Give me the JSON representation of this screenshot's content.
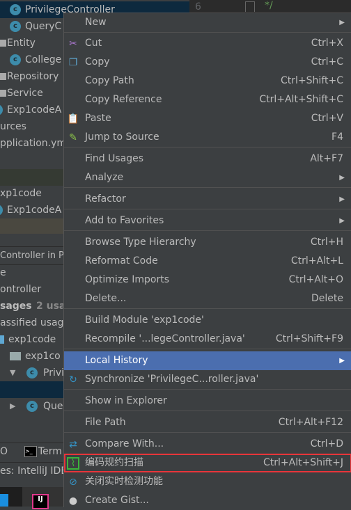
{
  "project_tree": [
    {
      "label": "PrivilegeController",
      "icon": "class-icon",
      "selected": true
    },
    {
      "label": "QueryC",
      "icon": "class-icon"
    },
    {
      "label": "Entity",
      "icon": "package-icon"
    },
    {
      "label": "College",
      "icon": "class-icon"
    },
    {
      "label": "Repository",
      "icon": "package-icon"
    },
    {
      "label": "Service",
      "icon": "package-icon"
    },
    {
      "label": "Exp1codeA",
      "icon": "spring-boot-class-icon"
    },
    {
      "label": "urces",
      "icon": ""
    },
    {
      "label": "pplication.ym",
      "icon": ""
    },
    {
      "label": "xp1code",
      "icon": ""
    },
    {
      "label": "Exp1codeA",
      "icon": "class-icon"
    }
  ],
  "find_panel": {
    "title": "Controller in Pr",
    "rows": [
      "e",
      "ontroller",
      "sages",
      "assified usage",
      "exp1code",
      "exp1co",
      "Privi",
      "Que"
    ],
    "usage_count": "2 usa"
  },
  "bottom_tabs": [
    "O",
    "Term"
  ],
  "status_text": "es: IntelliJ IDE",
  "editor": {
    "line_number": "6",
    "code": "*/"
  },
  "menu": {
    "items": [
      {
        "label": "New",
        "shortcut": "",
        "submenu": true
      },
      {
        "label": "Cut",
        "shortcut": "Ctrl+X",
        "icon": "scissors-icon"
      },
      {
        "label": "Copy",
        "shortcut": "Ctrl+C",
        "icon": "copy-icon"
      },
      {
        "label": "Copy Path",
        "shortcut": "Ctrl+Shift+C"
      },
      {
        "label": "Copy Reference",
        "shortcut": "Ctrl+Alt+Shift+C"
      },
      {
        "label": "Paste",
        "shortcut": "Ctrl+V",
        "icon": "paste-icon"
      },
      {
        "label": "Jump to Source",
        "shortcut": "F4",
        "icon": "edit-source-icon"
      },
      {
        "label": "Find Usages",
        "shortcut": "Alt+F7"
      },
      {
        "label": "Analyze",
        "shortcut": "",
        "submenu": true
      },
      {
        "label": "Refactor",
        "shortcut": "",
        "submenu": true
      },
      {
        "label": "Add to Favorites",
        "shortcut": "",
        "submenu": true
      },
      {
        "label": "Browse Type Hierarchy",
        "shortcut": "Ctrl+H"
      },
      {
        "label": "Reformat Code",
        "shortcut": "Ctrl+Alt+L"
      },
      {
        "label": "Optimize Imports",
        "shortcut": "Ctrl+Alt+O"
      },
      {
        "label": "Delete...",
        "shortcut": "Delete"
      },
      {
        "label": "Build Module 'exp1code'",
        "shortcut": ""
      },
      {
        "label": "Recompile '...legeController.java'",
        "shortcut": "Ctrl+Shift+F9"
      },
      {
        "label": "Local History",
        "shortcut": "",
        "submenu": true,
        "highlighted": true
      },
      {
        "label": "Synchronize 'PrivilegeC...roller.java'",
        "shortcut": "",
        "icon": "sync-icon"
      },
      {
        "label": "Show in Explorer",
        "shortcut": ""
      },
      {
        "label": "File Path",
        "shortcut": "Ctrl+Alt+F12"
      },
      {
        "label": "Compare With...",
        "shortcut": "Ctrl+D",
        "icon": "compare-icon"
      },
      {
        "label": "编码规约扫描",
        "shortcut": "Ctrl+Alt+Shift+J",
        "icon": "code-scan-icon",
        "boxed": true
      },
      {
        "label": "关闭实时检测功能",
        "shortcut": "",
        "icon": "disable-icon"
      },
      {
        "label": "Create Gist...",
        "shortcut": "",
        "icon": "github-icon"
      }
    ]
  },
  "colors": {
    "highlight": "#4b6eaf",
    "box": "#e8353a",
    "menu_bg": "#3c3f41"
  }
}
